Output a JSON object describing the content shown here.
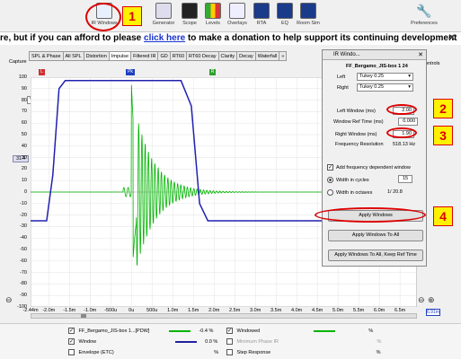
{
  "toolbar": {
    "items": [
      {
        "label": "IR Windows",
        "icon": "ir-windows-icon"
      },
      {
        "label": "Generator",
        "icon": "generator-icon"
      },
      {
        "label": "Scope",
        "icon": "scope-icon"
      },
      {
        "label": "Levels",
        "icon": "levels-icon"
      },
      {
        "label": "Overlays",
        "icon": "overlays-icon"
      },
      {
        "label": "RTA",
        "icon": "rta-icon"
      },
      {
        "label": "EQ",
        "icon": "eq-icon"
      },
      {
        "label": "Room Sim",
        "icon": "room-sim-icon"
      }
    ],
    "preferences_label": "Preferences"
  },
  "donation": {
    "before": "re, but if you can afford to please",
    "link": "click here",
    "after": "to make a donation to help support its continuing development"
  },
  "capture_label": "Capture",
  "tabs": [
    "SPL & Phase",
    "All SPL",
    "Distortion",
    "Impulse",
    "Filtered IR",
    "GD",
    "RT60",
    "RT60 Decay",
    "Clarity",
    "Decay",
    "Waterfall",
    "»"
  ],
  "active_tab": "Impulse",
  "percent_select": "%",
  "cursor_readout": "31.4",
  "y_ticks": [
    "100",
    "90",
    "80",
    "70",
    "60",
    "50",
    "40",
    "30",
    "20",
    "10",
    "0",
    "-10",
    "-20",
    "-30",
    "-40",
    "-50",
    "-60",
    "-70",
    "-80",
    "-90",
    "-100"
  ],
  "x_ticks": [
    "-2.44m",
    "-2.0m",
    "-1.5m",
    "-1.0m",
    "-500u",
    "0u",
    "500u",
    "1.0m",
    "1.5m",
    "2.0m",
    "2.5m",
    "3.0m",
    "3.5m",
    "4.0m",
    "4.5m",
    "5.0m",
    "5.5m",
    "6.0m",
    "6.5m"
  ],
  "x_end_label": "6.91m",
  "window_markers": {
    "left": "L",
    "peak": "Pk",
    "right": "R"
  },
  "legend": {
    "rows": [
      {
        "name": "FF_Bergamo_JIS-box 1...[PDW]",
        "value": "-0.4 %",
        "color": "#00b400",
        "checked": true
      },
      {
        "name": "Window",
        "value": "0.0 %",
        "color": "#2020a0",
        "checked": true
      },
      {
        "name": "Envelope (ETC)",
        "value": "%",
        "color": "#888888",
        "checked": false
      }
    ],
    "rows_right": [
      {
        "name": "Windowed",
        "value": "%",
        "color": "#00b400",
        "checked": true
      },
      {
        "name": "Minimum Phase IR",
        "value": "%",
        "color": "#aaaaaa",
        "checked": false
      },
      {
        "name": "Step Response",
        "value": "%",
        "color": "#888888",
        "checked": false
      }
    ]
  },
  "dialog": {
    "title": "IR Windo...",
    "measurement": "FF_Bergamo_JIS-box 1 24",
    "left_label": "Left",
    "left_value": "Tukey 0.25",
    "right_label": "Right",
    "right_value": "Tukey 0.25",
    "left_window_label": "Left Window (ms)",
    "left_window_value": "2.00",
    "ref_time_label": "Window Ref Time (ms)",
    "ref_time_value": "0.000",
    "right_window_label": "Right Window (ms)",
    "right_window_value": "1.90",
    "freq_res_label": "Frequency Resolution",
    "freq_res_value": "518.13 Hz",
    "add_freq_label": "Add frequency dependent window",
    "cycles_label": "Width in cycles",
    "cycles_value": "15",
    "octaves_label": "Width in octaves",
    "octaves_value": "1/ 20.8",
    "apply_windows": "Apply Windows",
    "apply_all": "Apply Windows To All",
    "apply_keep": "Apply Windows To All, Keep Ref Time"
  },
  "controls_fragment": "ontrols",
  "callouts": [
    "1",
    "2",
    "3",
    "4"
  ],
  "colors": {
    "impulse": "#00b400",
    "window": "#2020b0",
    "accent": "#d00000",
    "callout_bg": "#fff200"
  }
}
